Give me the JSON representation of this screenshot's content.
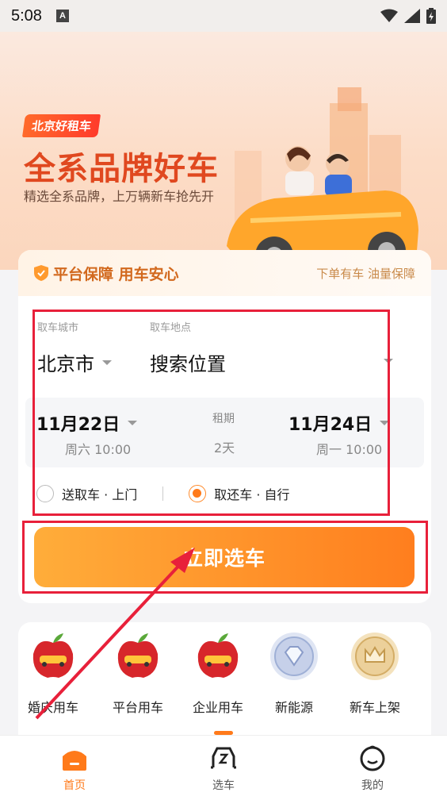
{
  "status_bar": {
    "time": "5:08",
    "notif_letter": "A",
    "icons": [
      "wifi-icon",
      "signal-icon",
      "battery-icon"
    ]
  },
  "hero": {
    "badge": "北京好租车",
    "title": "全系品牌好车",
    "subtitle": "精选全系品牌，上万辆新车抢先开"
  },
  "card": {
    "head_title": "平台保障 用车安心",
    "head_right": "下单有车 油量保障",
    "city_label": "取车城市",
    "city_value": "北京市",
    "place_label": "取车地点",
    "place_value": "搜索位置",
    "start_date": "11月22日",
    "start_sub": "周六 10:00",
    "period_label": "租期",
    "period_value": "2天",
    "end_date": "11月24日",
    "end_sub": "周一 10:00",
    "option_delivery": "送取车 · 上门",
    "option_self": "取还车 · 自行",
    "selected_option": "option_self",
    "cta": "立即选车"
  },
  "services": [
    {
      "label": "婚庆用车",
      "icon": "apple-car-icon"
    },
    {
      "label": "平台用车",
      "icon": "apple-car-icon"
    },
    {
      "label": "企业用车",
      "icon": "apple-car-icon"
    },
    {
      "label": "新能源",
      "icon": "diamond-badge-icon"
    },
    {
      "label": "新车上架",
      "icon": "crown-badge-icon"
    }
  ],
  "tabs": [
    {
      "label": "首页",
      "icon": "home-icon",
      "active": true
    },
    {
      "label": "选车",
      "icon": "car-select-icon",
      "active": false
    },
    {
      "label": "我的",
      "icon": "profile-icon",
      "active": false
    }
  ],
  "colors": {
    "accent": "#ff7a1a",
    "annotation": "#e8203a",
    "hero_title": "#e0481f"
  }
}
